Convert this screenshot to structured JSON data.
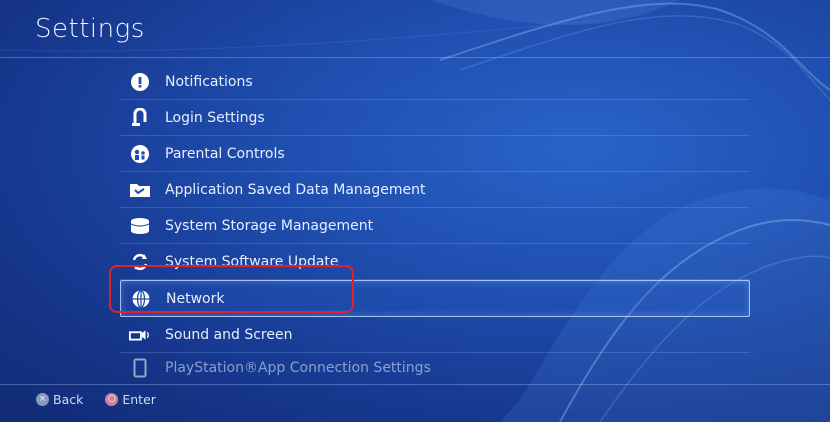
{
  "header": {
    "title": "Settings"
  },
  "menu": {
    "items": [
      {
        "label": "Notifications",
        "icon": "notification-icon"
      },
      {
        "label": "Login Settings",
        "icon": "login-icon"
      },
      {
        "label": "Parental Controls",
        "icon": "parental-controls-icon"
      },
      {
        "label": "Application Saved Data Management",
        "icon": "folder-icon"
      },
      {
        "label": "System Storage Management",
        "icon": "storage-icon"
      },
      {
        "label": "System Software Update",
        "icon": "update-icon"
      },
      {
        "label": "Network",
        "icon": "globe-icon",
        "selected": true
      },
      {
        "label": "Sound and Screen",
        "icon": "sound-screen-icon"
      },
      {
        "label": "PlayStation®App Connection Settings",
        "icon": "phone-icon"
      }
    ]
  },
  "footer": {
    "back_label": "Back",
    "enter_label": "Enter",
    "back_glyph": "×",
    "enter_glyph": "○"
  },
  "colors": {
    "highlight": "#e0222f",
    "background": "#1f4fb0"
  }
}
